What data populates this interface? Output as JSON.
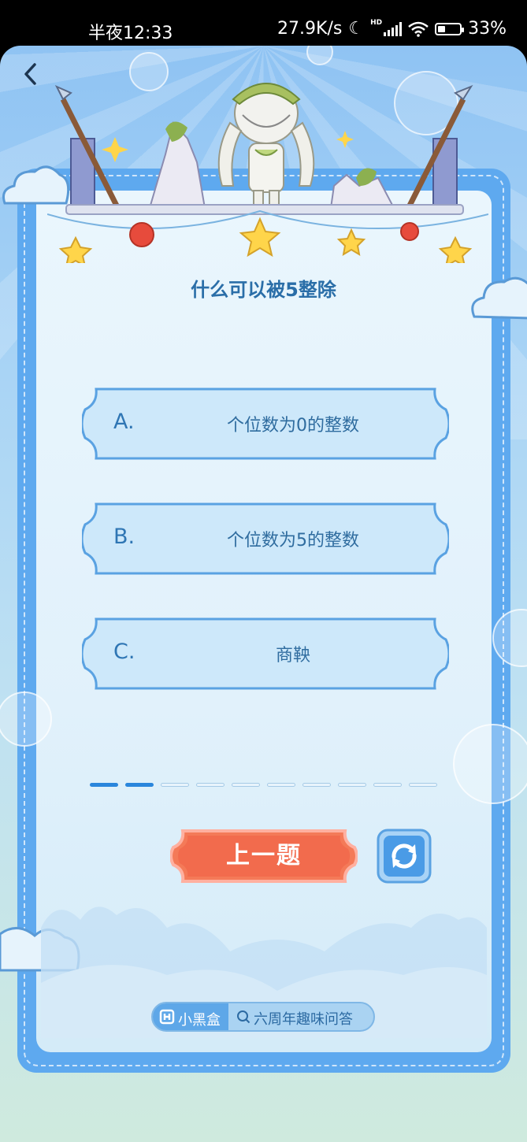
{
  "status_bar": {
    "time": "半夜12:33",
    "network_speed": "27.9K/s",
    "hd_label": "HD",
    "battery": "33%"
  },
  "quiz": {
    "question": "什么可以被5整除",
    "options": [
      {
        "letter": "A.",
        "text": "个位数为0的整数"
      },
      {
        "letter": "B.",
        "text": "个位数为5的整数"
      },
      {
        "letter": "C.",
        "text": "商鞅"
      }
    ],
    "progress": {
      "current": 2,
      "total": 10
    },
    "prev_button": "上一题"
  },
  "branding": {
    "app_name": "小黑盒",
    "topic": "六周年趣味问答"
  },
  "colors": {
    "frame": "#5ea9ef",
    "title": "#2a6ea8",
    "prev_button": "#f26b4d",
    "refresh_button": "#4a9be6"
  },
  "icons": [
    "back-arrow-icon",
    "moon-icon",
    "signal-icon",
    "wifi-icon",
    "battery-icon",
    "refresh-icon",
    "brand-logo-icon",
    "search-icon"
  ]
}
